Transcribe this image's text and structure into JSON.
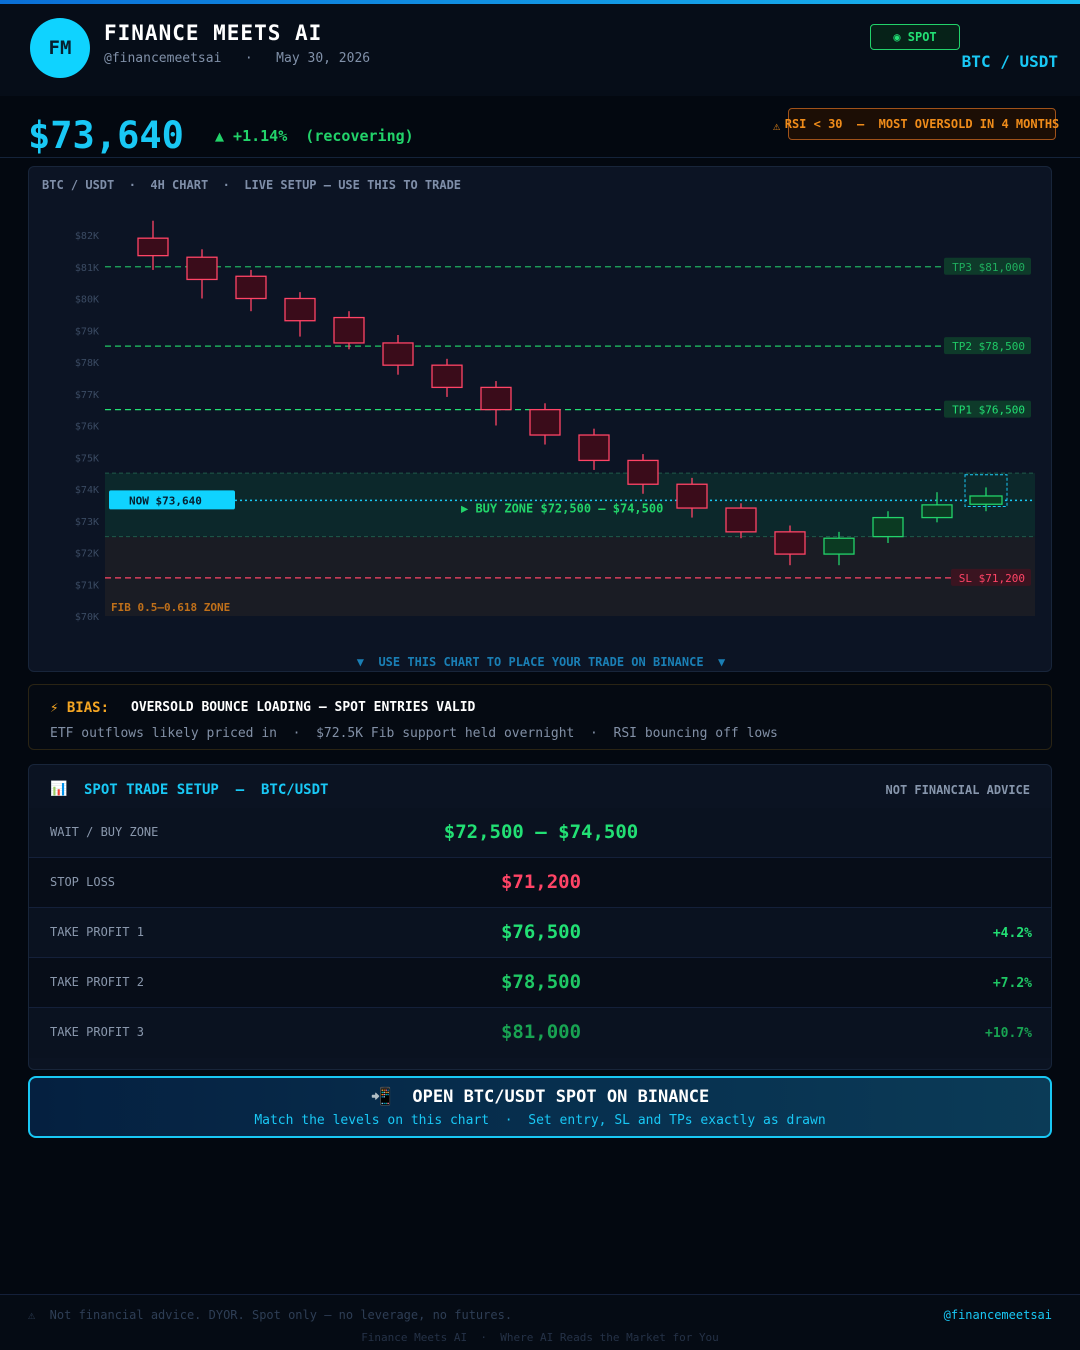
{
  "header": {
    "avatar": "FM",
    "name": "FINANCE MEETS AI",
    "handle_date": "@financemeetsai   ·   May 30, 2026",
    "spot_badge": "◉ SPOT",
    "pair": "BTC / USDT"
  },
  "price": {
    "value": "$73,640",
    "change": "▲ +1.14%  (recovering)",
    "rsi_icon": "⚠",
    "rsi_badge": "RSI < 30  —  MOST OVERSOLD IN 4 MONTHS"
  },
  "chart": {
    "title": "BTC / USDT  ·  4H CHART  ·  LIVE SETUP — USE THIS TO TRADE",
    "footer": "▼  USE THIS CHART TO PLACE YOUR TRADE ON BINANCE  ▼"
  },
  "chart_data": {
    "type": "candlestick",
    "title": "BTC / USDT  ·  4H CHART  ·  LIVE SETUP — USE THIS TO TRADE",
    "ylim": [
      70000,
      82500
    ],
    "y_ticks": [
      "$82K",
      "$81K",
      "$80K",
      "$79K",
      "$78K",
      "$77K",
      "$76K",
      "$75K",
      "$74K",
      "$73K",
      "$72K",
      "$71K",
      "$70K"
    ],
    "y_tick_values": [
      82000,
      81000,
      80000,
      79000,
      78000,
      77000,
      76000,
      75000,
      74000,
      73000,
      72000,
      71000,
      70000
    ],
    "candles": [
      {
        "o": 81900,
        "c": 81350,
        "h": 82450,
        "l": 80900,
        "dir": "down"
      },
      {
        "o": 81300,
        "c": 80600,
        "h": 81550,
        "l": 80000,
        "dir": "down"
      },
      {
        "o": 80700,
        "c": 80000,
        "h": 80900,
        "l": 79600,
        "dir": "down"
      },
      {
        "o": 80000,
        "c": 79300,
        "h": 80200,
        "l": 78800,
        "dir": "down"
      },
      {
        "o": 79400,
        "c": 78600,
        "h": 79600,
        "l": 78400,
        "dir": "down"
      },
      {
        "o": 78600,
        "c": 77900,
        "h": 78850,
        "l": 77600,
        "dir": "down"
      },
      {
        "o": 77900,
        "c": 77200,
        "h": 78100,
        "l": 76900,
        "dir": "down"
      },
      {
        "o": 77200,
        "c": 76500,
        "h": 77400,
        "l": 76000,
        "dir": "down"
      },
      {
        "o": 76500,
        "c": 75700,
        "h": 76700,
        "l": 75400,
        "dir": "down"
      },
      {
        "o": 75700,
        "c": 74900,
        "h": 75900,
        "l": 74600,
        "dir": "down"
      },
      {
        "o": 74900,
        "c": 74150,
        "h": 75100,
        "l": 73850,
        "dir": "down"
      },
      {
        "o": 74150,
        "c": 73400,
        "h": 74350,
        "l": 73100,
        "dir": "down"
      },
      {
        "o": 73400,
        "c": 72650,
        "h": 73550,
        "l": 72450,
        "dir": "down"
      },
      {
        "o": 72650,
        "c": 71950,
        "h": 72850,
        "l": 71600,
        "dir": "down"
      },
      {
        "o": 71950,
        "c": 72450,
        "h": 72650,
        "l": 71600,
        "dir": "up"
      },
      {
        "o": 72500,
        "c": 73100,
        "h": 73300,
        "l": 72300,
        "dir": "up"
      },
      {
        "o": 73100,
        "c": 73500,
        "h": 73900,
        "l": 72950,
        "dir": "up"
      },
      {
        "o": 73520,
        "c": 73780,
        "h": 74050,
        "l": 73300,
        "dir": "up",
        "current": true
      }
    ],
    "levels": [
      {
        "label": "TP3 $81,000",
        "value": 81000,
        "color": "#1fae5e",
        "style": "dashed"
      },
      {
        "label": "TP2 $78,500",
        "value": 78500,
        "color": "#1fc865",
        "style": "dashed"
      },
      {
        "label": "TP1 $76,500",
        "value": 76500,
        "color": "#22e074",
        "style": "dashed"
      },
      {
        "label": "SL $71,200",
        "value": 71200,
        "color": "#ff4466",
        "style": "dashed"
      }
    ],
    "now": {
      "label": "NOW  $73,640",
      "value": 73640
    },
    "buy_zone": {
      "label": "▶  BUY ZONE  $72,500 — $74,500",
      "low": 72500,
      "high": 74500
    },
    "fib_zone": {
      "label": "FIB 0.5–0.618 ZONE",
      "low": 70000,
      "high": 72500
    }
  },
  "bias": {
    "label": "⚡ BIAS:",
    "text": "OVERSOLD BOUNCE LOADING — SPOT ENTRIES VALID",
    "sub": "ETF outflows likely priced in  ·  $72.5K Fib support held overnight  ·  RSI bouncing off lows"
  },
  "setup": {
    "icon": "📊",
    "title": "SPOT TRADE SETUP  —  BTC/USDT",
    "nfa": "NOT FINANCIAL ADVICE",
    "rows": [
      {
        "label": "WAIT / BUY ZONE",
        "value": "$72,500 — $74,500",
        "pct": ""
      },
      {
        "label": "STOP LOSS",
        "value": "$71,200",
        "pct": ""
      },
      {
        "label": "TAKE PROFIT 1",
        "value": "$76,500",
        "pct": "+4.2%"
      },
      {
        "label": "TAKE PROFIT 2",
        "value": "$78,500",
        "pct": "+7.2%"
      },
      {
        "label": "TAKE PROFIT 3",
        "value": "$81,000",
        "pct": "+10.7%"
      }
    ]
  },
  "cta": {
    "title": "📲  OPEN BTC/USDT SPOT ON BINANCE",
    "sub": "Match the levels on this chart  ·  Set entry, SL and TPs exactly as drawn"
  },
  "footer": {
    "disclaimer": "⚠  Not financial advice. DYOR. Spot only — no leverage, no futures.",
    "handle": "@financemeetsai",
    "tagline": "Finance Meets AI  ·  Where AI Reads the Market for You"
  },
  "colors": {
    "accent": "#19c8f5",
    "green": "#22e074",
    "red": "#ff4466",
    "orange": "#f08c1a",
    "background": "#030810"
  }
}
